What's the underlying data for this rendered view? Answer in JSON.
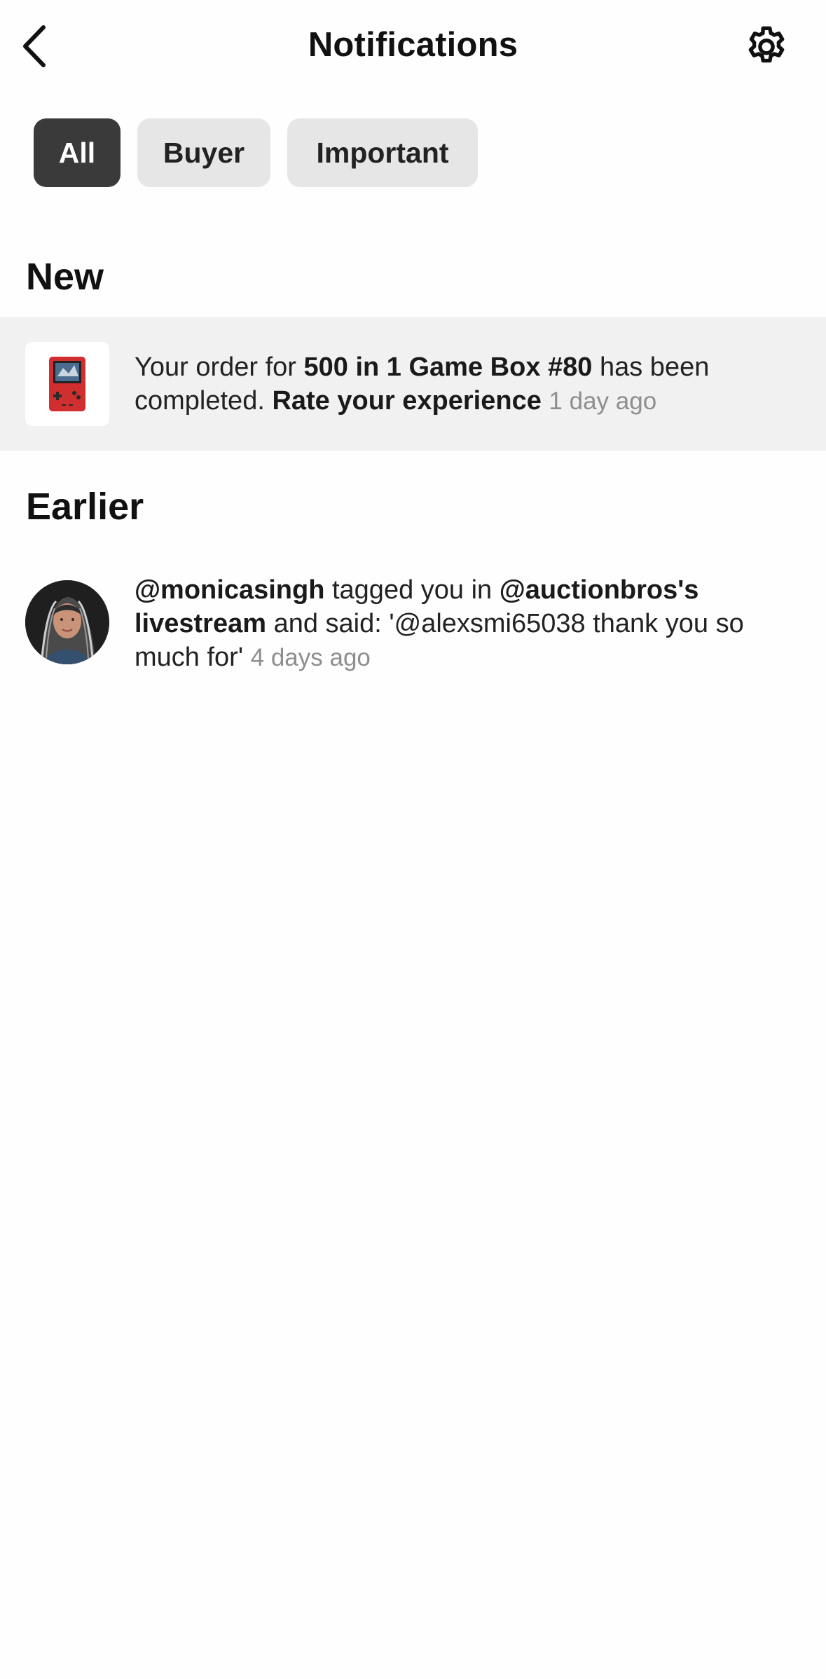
{
  "header": {
    "title": "Notifications",
    "back_icon": "chevron-left-icon",
    "settings_icon": "gear-icon"
  },
  "filters": [
    {
      "label": "All",
      "active": true
    },
    {
      "label": "Buyer",
      "active": false
    },
    {
      "label": "Important",
      "active": false
    }
  ],
  "sections": {
    "new": {
      "title": "New",
      "items": [
        {
          "thumbnail": "handheld-game-console",
          "prefix": "Your order for ",
          "item_name": "500 in 1 Game Box #80",
          "middle": " has been completed. ",
          "cta": "Rate your experience",
          "time": "1 day ago"
        }
      ]
    },
    "earlier": {
      "title": "Earlier",
      "items": [
        {
          "avatar": "user-avatar",
          "user": "@monicasingh",
          "middle": " tagged you in ",
          "stream": "@auctionbros's livestream",
          "message": " and said: '@alexsmi65038 thank you so much for'",
          "time": "4 days ago"
        }
      ]
    }
  },
  "colors": {
    "chip_active_bg": "#3a3a3a",
    "chip_inactive_bg": "#e6e6e6",
    "new_row_bg": "#f1f1f1",
    "time_text": "#8e8e8e"
  }
}
